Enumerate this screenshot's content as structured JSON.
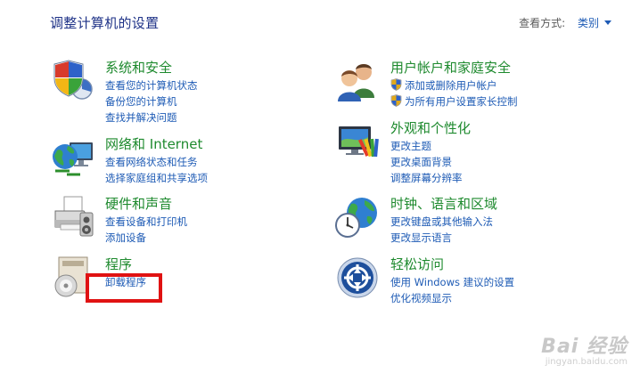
{
  "header": {
    "title": "调整计算机的设置",
    "view_by_label": "查看方式:",
    "view_by_value": "类别"
  },
  "categories": [
    {
      "title": "系统和安全",
      "icon": "shield-icon",
      "links": [
        "查看您的计算机状态",
        "备份您的计算机",
        "查找并解决问题"
      ]
    },
    {
      "title": "网络和 Internet",
      "icon": "network-globe-icon",
      "links": [
        "查看网络状态和任务",
        "选择家庭组和共享选项"
      ]
    },
    {
      "title": "硬件和声音",
      "icon": "printer-icon",
      "links": [
        "查看设备和打印机",
        "添加设备"
      ]
    },
    {
      "title": "程序",
      "icon": "programs-disc-icon",
      "links": [
        "卸载程序"
      ]
    },
    {
      "title": "用户帐户和家庭安全",
      "icon": "users-icon",
      "links": [
        "添加或删除用户帐户",
        "为所有用户设置家长控制"
      ]
    },
    {
      "title": "外观和个性化",
      "icon": "monitor-palette-icon",
      "links": [
        "更改主题",
        "更改桌面背景",
        "调整屏幕分辨率"
      ]
    },
    {
      "title": "时钟、语言和区域",
      "icon": "clock-globe-icon",
      "links": [
        "更改键盘或其他输入法",
        "更改显示语言"
      ]
    },
    {
      "title": "轻松访问",
      "icon": "ease-of-access-icon",
      "links": [
        "使用 Windows 建议的设置",
        "优化视频显示"
      ]
    }
  ],
  "watermark": {
    "main": "Bai 经验",
    "sub": "jingyan.baidu.com"
  },
  "colors": {
    "title": "#1e3287",
    "category_title": "#1e8a2e",
    "link": "#1e5bb5",
    "highlight": "#e01212"
  }
}
